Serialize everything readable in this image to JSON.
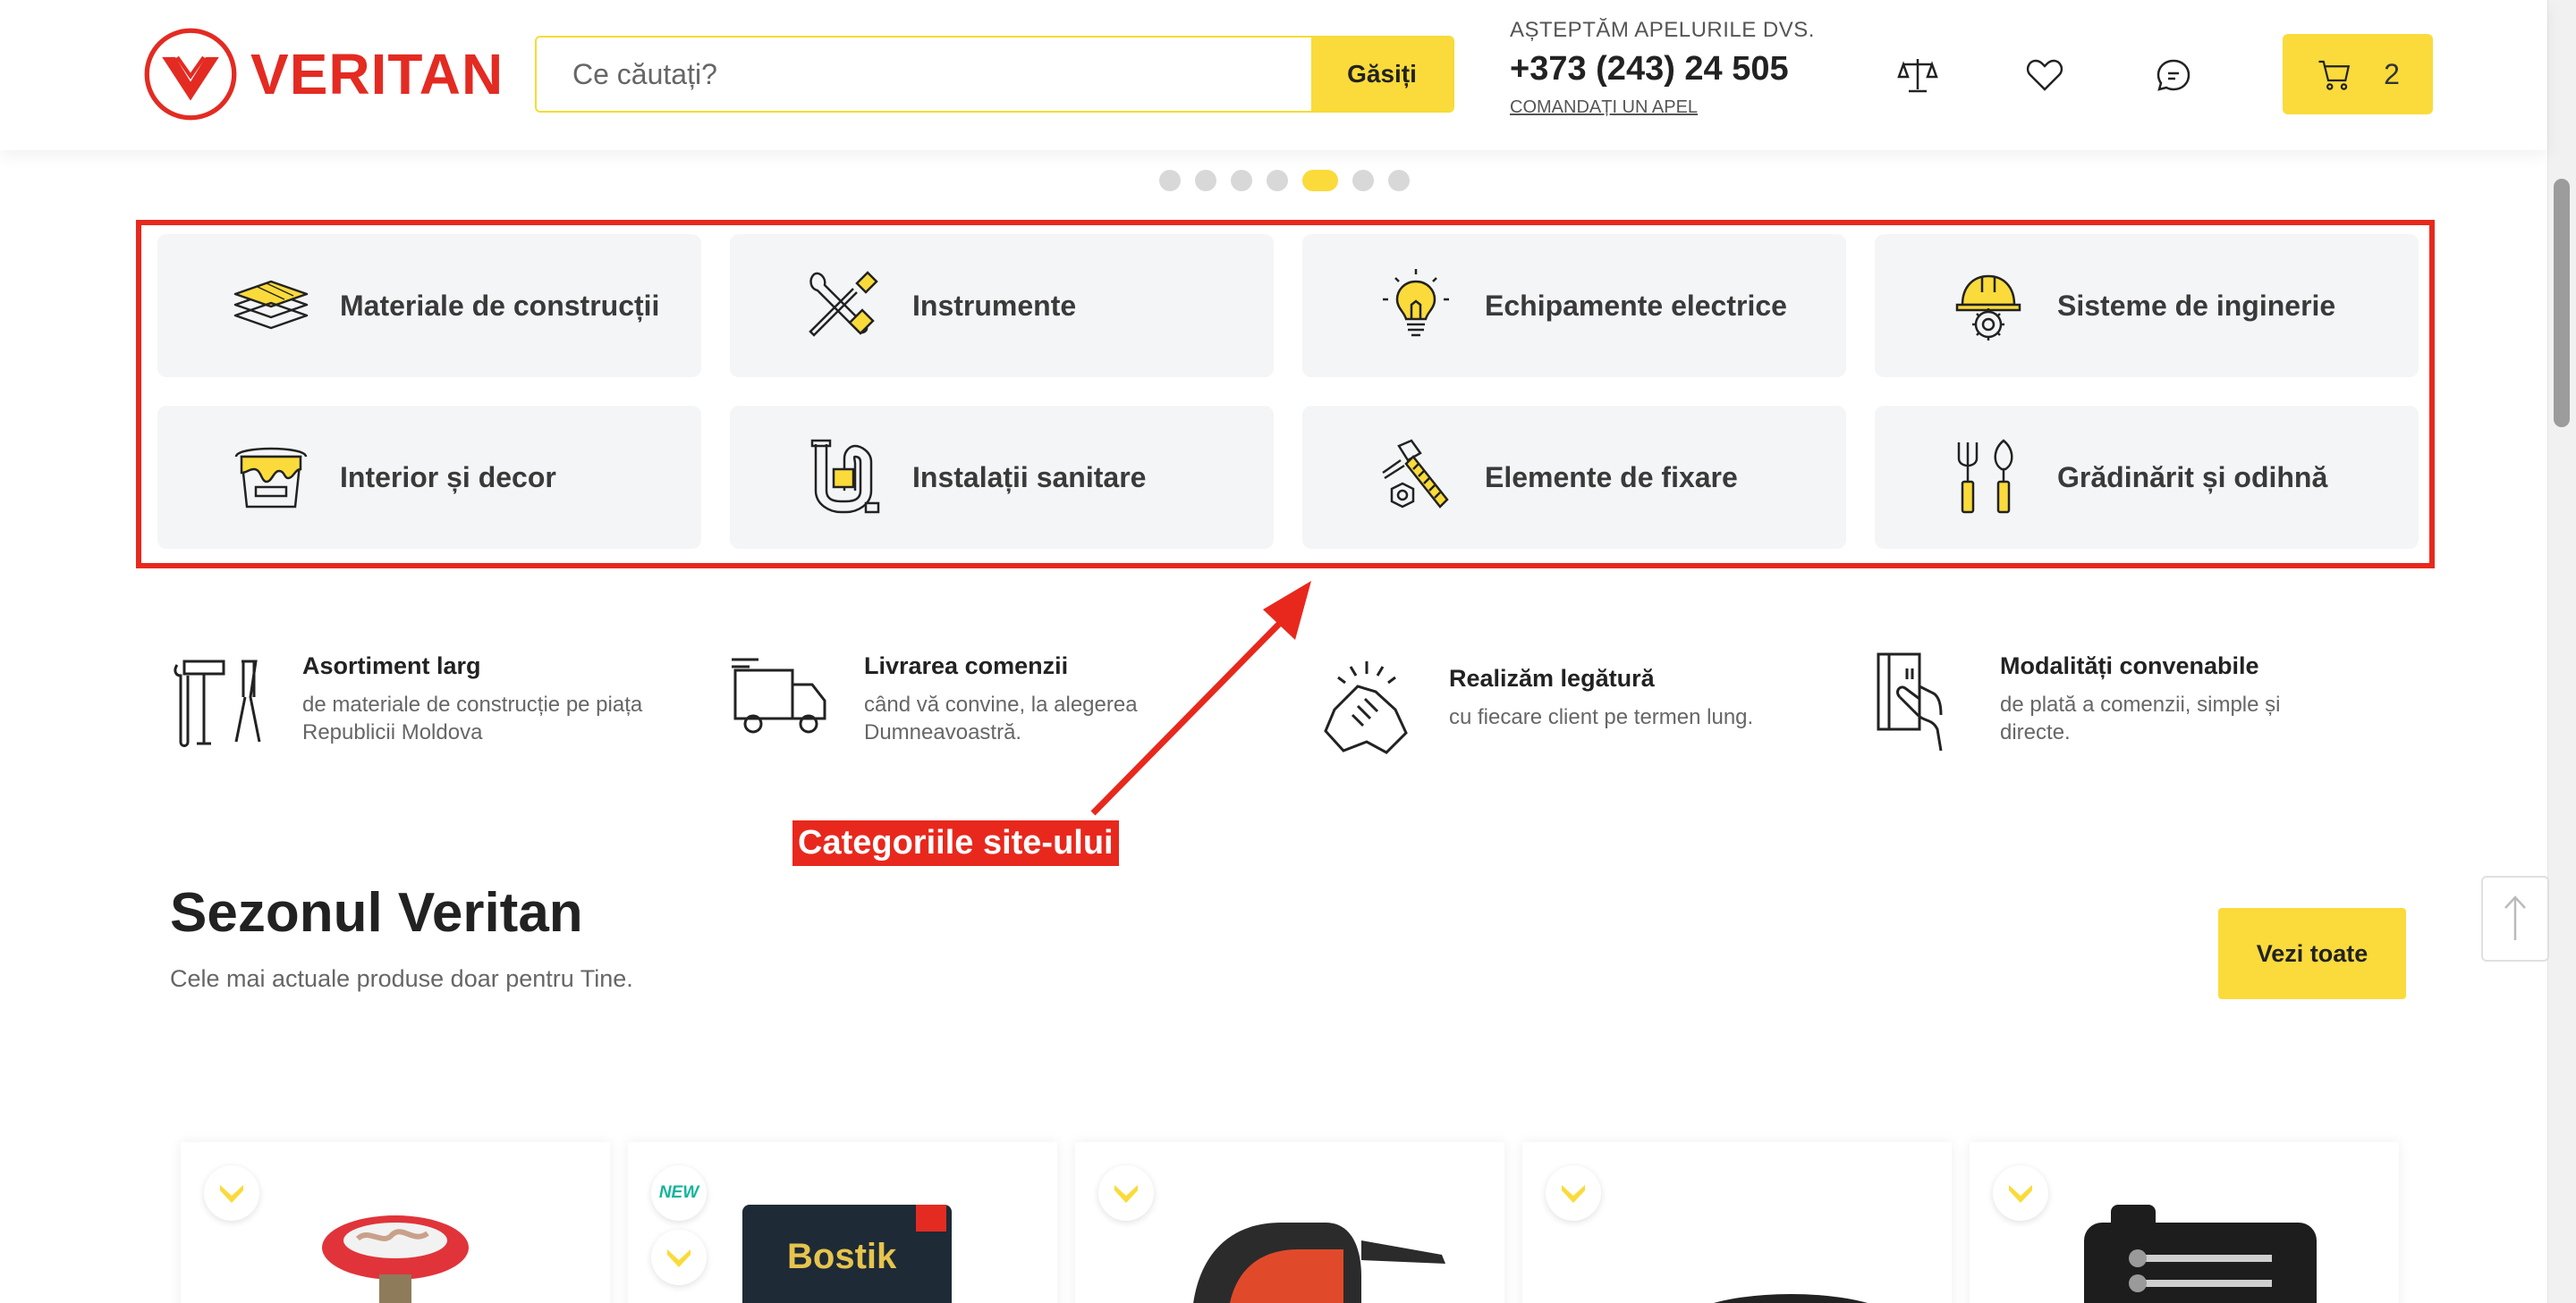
{
  "header": {
    "logo_text": "VERITAN",
    "search": {
      "placeholder": "Ce căutați?",
      "button_label": "Găsiți"
    },
    "call": {
      "top_text": "AȘTEPTĂM APELURILE DVS.",
      "phone": "+373 (243) 24 505",
      "link_label": "COMANDAȚI UN APEL"
    },
    "icons": [
      "scale-icon",
      "heart-icon",
      "chat-icon",
      "cart-icon"
    ],
    "cart_count": "2"
  },
  "carousel": {
    "dot_count": 7,
    "active_index": 4
  },
  "categories": [
    {
      "label": "Materiale de construcții",
      "icon": "layers-icon"
    },
    {
      "label": "Instrumente",
      "icon": "tools-icon"
    },
    {
      "label": "Echipamente electrice",
      "icon": "bulb-icon"
    },
    {
      "label": "Sisteme de inginerie",
      "icon": "helmet-gear-icon"
    },
    {
      "label": "Interior și decor",
      "icon": "paint-bucket-icon"
    },
    {
      "label": "Instalații sanitare",
      "icon": "pipe-icon"
    },
    {
      "label": "Elemente de fixare",
      "icon": "bolt-nut-icon"
    },
    {
      "label": "Grădinărit și odihnă",
      "icon": "garden-tools-icon"
    }
  ],
  "features": [
    {
      "title": "Asortiment larg",
      "desc_line1": "de materiale de construcție pe piața",
      "desc_line2": "Republicii Moldova",
      "icon": "hammer-wrench-icon"
    },
    {
      "title": "Livrarea comenzii",
      "desc_line1": "când vă convine, la alegerea",
      "desc_line2": "Dumneavoastră.",
      "icon": "truck-icon"
    },
    {
      "title": "Realizăm legătură",
      "desc_line1": "cu fiecare client pe termen lung.",
      "desc_line2": "",
      "icon": "handshake-icon"
    },
    {
      "title": "Modalități convenabile",
      "desc_line1": "de plată a comenzii, simple și",
      "desc_line2": "directe.",
      "icon": "card-hand-icon"
    }
  ],
  "annotation": {
    "label": "Categoriile site-ului"
  },
  "season": {
    "title": "Sezonul Veritan",
    "subtitle": "Cele mai actuale produse doar pentru Tine.",
    "see_all_label": "Vezi toate"
  },
  "products": [
    {
      "image": "red-valve",
      "badges": [
        "chevron"
      ]
    },
    {
      "image": "bostik-glue",
      "badges": [
        "new",
        "chevron"
      ],
      "brand": "Bostik",
      "new_label": "NEW"
    },
    {
      "image": "circular-saw",
      "badges": [
        "chevron"
      ]
    },
    {
      "image": "cable",
      "badges": [
        "chevron"
      ]
    },
    {
      "image": "socket-set",
      "badges": [
        "chevron"
      ]
    }
  ],
  "colors": {
    "accent_yellow": "#fadb3b",
    "brand_red": "#e32b22",
    "annotation_red": "#e8281d"
  }
}
